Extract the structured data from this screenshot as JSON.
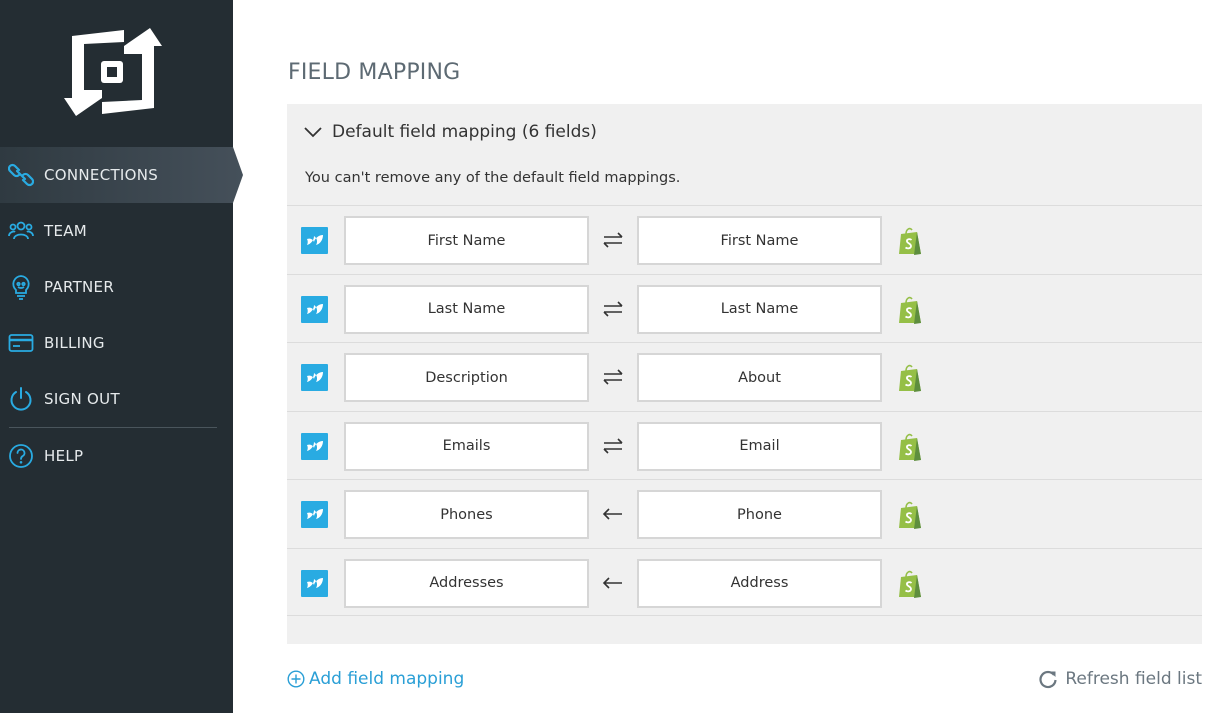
{
  "sidebar": {
    "logo_icon": "brand-logo-icon",
    "items": [
      {
        "label": "CONNECTIONS",
        "icon": "link-icon",
        "active": true
      },
      {
        "label": "TEAM",
        "icon": "team-icon",
        "active": false
      },
      {
        "label": "PARTNER",
        "icon": "lightbulb-icon",
        "active": false
      },
      {
        "label": "BILLING",
        "icon": "credit-card-icon",
        "active": false
      },
      {
        "label": "SIGN OUT",
        "icon": "power-icon",
        "active": false
      },
      {
        "label": "HELP",
        "icon": "help-icon",
        "active": false
      }
    ]
  },
  "main": {
    "title": "FIELD MAPPING",
    "panel": {
      "title": "Default field mapping (6 fields)",
      "note": "You can't remove any of the default field mappings.",
      "rows": [
        {
          "left": "First Name",
          "right": "First Name",
          "direction": "both"
        },
        {
          "left": "Last Name",
          "right": "Last Name",
          "direction": "both"
        },
        {
          "left": "Description",
          "right": "About",
          "direction": "both"
        },
        {
          "left": "Emails",
          "right": "Email",
          "direction": "both"
        },
        {
          "left": "Phones",
          "right": "Phone",
          "direction": "left"
        },
        {
          "left": "Addresses",
          "right": "Address",
          "direction": "left"
        }
      ]
    },
    "add_label": "Add field mapping",
    "refresh_label": "Refresh field list"
  },
  "colors": {
    "sidebar_bg": "#242d33",
    "accent_blue": "#29abe2",
    "link_blue": "#2a9fd6",
    "shopify_green": "#95bf47",
    "panel_bg": "#f0f0f0"
  }
}
